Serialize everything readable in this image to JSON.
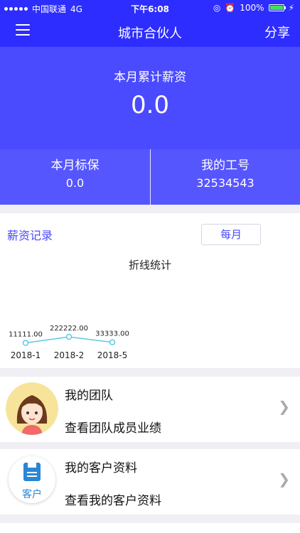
{
  "status": {
    "carrier": "中国联通",
    "network": "4G",
    "time": "下午6:08",
    "battery": "100%",
    "battery_level": 1.0
  },
  "nav": {
    "title": "城市合伙人",
    "share": "分享"
  },
  "hero": {
    "label": "本月累计薪资",
    "value": "0.0"
  },
  "stats": [
    {
      "title": "本月标保",
      "value": "0.0"
    },
    {
      "title": "我的工号",
      "value": "32534543"
    }
  ],
  "salary": {
    "title": "薪资记录",
    "period_button": "每月",
    "chart_title": "折线统计"
  },
  "chart_data": {
    "type": "line",
    "title": "折线统计",
    "categories": [
      "2018-1",
      "2018-2",
      "2018-5"
    ],
    "series": [
      {
        "values": [
          11111.0,
          222222.0,
          33333.0
        ]
      }
    ],
    "data_labels": [
      "11111.00",
      "222222.00",
      "33333.00"
    ],
    "color": "#5bc8e6"
  },
  "team": {
    "title": "我的团队",
    "subtitle": "查看团队成员业绩"
  },
  "client": {
    "title": "我的客户资料",
    "subtitle": "查看我的客户资料",
    "badge": "客户"
  },
  "colors": {
    "primary": "#2d2dff",
    "hero": "#4a4aff",
    "accent": "#4a4aff"
  }
}
